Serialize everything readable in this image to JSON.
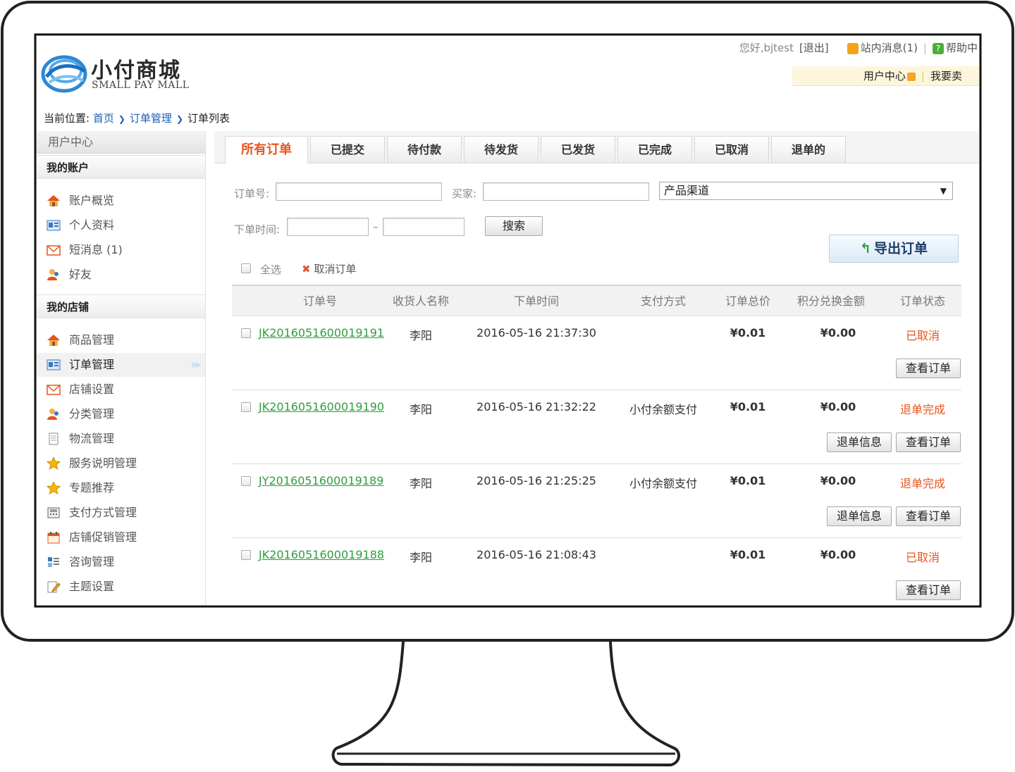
{
  "header": {
    "logo_title": "小付商城",
    "logo_sub": "SMALL PAY MALL",
    "greeting": "您好,bjtest",
    "logout": "[退出]",
    "messages": "站内消息(1)",
    "help": "帮助中",
    "user_center": "用户中心",
    "sell": "我要卖"
  },
  "breadcrumb": {
    "prefix": "当前位置:",
    "home": "首页",
    "level2": "订单管理",
    "current": "订单列表"
  },
  "sidebar": {
    "title": "用户中心",
    "groups": [
      {
        "label": "我的账户",
        "items": [
          "账户概览",
          "个人资料",
          "短消息 (1)",
          "好友"
        ]
      },
      {
        "label": "我的店铺",
        "items": [
          "商品管理",
          "订单管理",
          "店铺设置",
          "分类管理",
          "物流管理",
          "服务说明管理",
          "专题推荐",
          "支付方式管理",
          "店铺促销管理",
          "咨询管理",
          "主题设置"
        ]
      }
    ]
  },
  "tabs": [
    "所有订单",
    "已提交",
    "待付款",
    "待发货",
    "已发货",
    "已完成",
    "已取消",
    "退单的"
  ],
  "filters": {
    "order_no_label": "订单号:",
    "buyer_label": "买家:",
    "channel": "产品渠道",
    "time_label": "下单时间:",
    "dash": "–",
    "search": "搜索",
    "export": "导出订单",
    "select_all": "全选",
    "cancel_order": "取消订单"
  },
  "table": {
    "columns": [
      "订单号",
      "收货人名称",
      "下单时间",
      "支付方式",
      "订单总价",
      "积分兑换金额",
      "订单状态"
    ],
    "rows": [
      {
        "order": "JK2016051600019191",
        "receiver": "李阳",
        "time": "2016-05-16 21:37:30",
        "payment": "",
        "total": "¥0.01",
        "points": "¥0.00",
        "status": "已取消",
        "buttons": [
          "查看订单"
        ]
      },
      {
        "order": "JK2016051600019190",
        "receiver": "李阳",
        "time": "2016-05-16 21:32:22",
        "payment": "小付余额支付",
        "total": "¥0.01",
        "points": "¥0.00",
        "status": "退单完成",
        "buttons": [
          "退单信息",
          "查看订单"
        ]
      },
      {
        "order": "JY2016051600019189",
        "receiver": "李阳",
        "time": "2016-05-16 21:25:25",
        "payment": "小付余额支付",
        "total": "¥0.01",
        "points": "¥0.00",
        "status": "退单完成",
        "buttons": [
          "退单信息",
          "查看订单"
        ]
      },
      {
        "order": "JK2016051600019188",
        "receiver": "李阳",
        "time": "2016-05-16 21:08:43",
        "payment": "",
        "total": "¥0.01",
        "points": "¥0.00",
        "status": "已取消",
        "buttons": [
          "查看订单"
        ]
      }
    ]
  }
}
